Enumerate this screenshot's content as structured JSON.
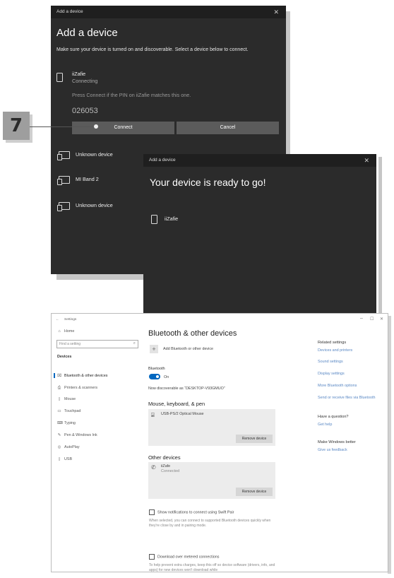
{
  "dialog1": {
    "titlebar": "Add a device",
    "heading": "Add a device",
    "description": "Make sure your device is turned on and discoverable. Select a device below to connect.",
    "device_name": "iiZafie",
    "device_status": "Connecting",
    "pin_prompt": "Press Connect if the PIN on iiZafie matches this one.",
    "pin": "026053",
    "connect_label": "Connect",
    "cancel_label": "Cancel",
    "devices": [
      "Unknown device",
      "MI Band 2",
      "Unknown device"
    ]
  },
  "callout": {
    "step": "7"
  },
  "dialog2": {
    "titlebar": "Add a device",
    "heading": "Your device is ready to go!",
    "device_name": "iiZafie"
  },
  "settings": {
    "window_title": "Settings",
    "nav": {
      "home": "Home",
      "search_placeholder": "Find a setting",
      "section": "Devices",
      "items": [
        "Bluetooth & other devices",
        "Printers & scanners",
        "Mouse",
        "Touchpad",
        "Typing",
        "Pen & Windows Ink",
        "AutoPlay",
        "USB"
      ]
    },
    "main": {
      "title": "Bluetooth & other devices",
      "add_label": "Add Bluetooth or other device",
      "bluetooth_label": "Bluetooth",
      "bluetooth_state": "On",
      "discoverable": "Now discoverable as “DESKTOP-V93GMUO”",
      "mouse_section": "Mouse, keyboard, & pen",
      "mouse_device": "USB-PS/2 Optical Mouse",
      "remove_label": "Remove device",
      "other_section": "Other devices",
      "other_device": "iiZafe",
      "other_status": "Connected",
      "swift_pair": "Show notifications to connect using Swift Pair",
      "swift_desc": "When selected, you can connect to supported Bluetooth devices quickly when they're close by and in pairing mode.",
      "metered": "Download over metered connections",
      "metered_desc": "To help prevent extra charges, keep this off so device software (drivers, info, and apps) for new devices won't download while"
    },
    "related": {
      "heading": "Related settings",
      "links": [
        "Devices and printers",
        "Sound settings",
        "Display settings",
        "More Bluetooth options",
        "Send or receive files via Bluetooth"
      ],
      "question": "Have a question?",
      "help": "Get help",
      "better": "Make Windows better",
      "feedback": "Give us feedback"
    }
  },
  "colors": {
    "toggle": "#0067c0",
    "link": "#5a88c4",
    "dialog_bg": "#2b2b2b"
  }
}
